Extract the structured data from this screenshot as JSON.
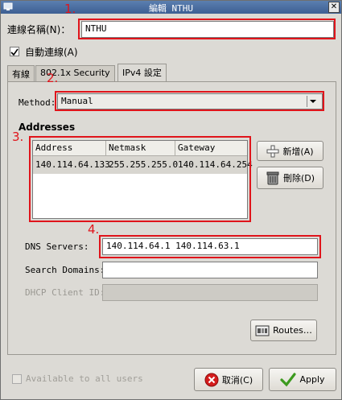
{
  "window": {
    "title": "編輯 NTHU",
    "close_glyph": "✕"
  },
  "connection": {
    "name_label": "連線名稱(N)：",
    "name_value": "NTHU",
    "auto_connect_label": "自動連線(A)",
    "auto_connect_checked": true
  },
  "tabs": [
    {
      "label": "有線"
    },
    {
      "label": "802.1x Security"
    },
    {
      "label": "IPv4 設定",
      "active": true
    }
  ],
  "ipv4": {
    "method_label": "Method:",
    "method_value": "Manual",
    "addresses_heading": "Addresses",
    "table": {
      "columns": [
        "Address",
        "Netmask",
        "Gateway"
      ],
      "rows": [
        {
          "address": "140.114.64.133",
          "netmask": "255.255.255.0",
          "gateway": "140.114.64.254"
        }
      ]
    },
    "add_label": "新增(A)",
    "delete_label": "刪除(D)",
    "dns_label": "DNS Servers:",
    "dns_value": "140.114.64.1 140.114.63.1",
    "search_label": "Search Domains:",
    "search_value": "",
    "dhcp_label": "DHCP Client ID:",
    "dhcp_value": "",
    "routes_label": "Routes…"
  },
  "footer": {
    "available_label": "Available to all users",
    "cancel_label": "取消(C)",
    "apply_label": "Apply"
  },
  "annotations": [
    "1.",
    "2.",
    "3.",
    "4."
  ],
  "colors": {
    "annotation": "#e0141b",
    "titlebar": "#3d5f93"
  }
}
